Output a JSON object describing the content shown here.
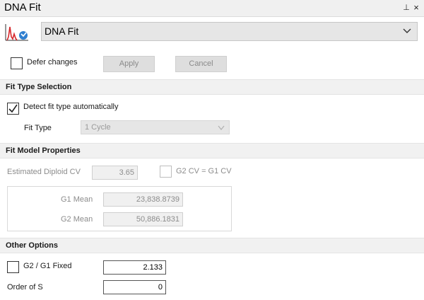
{
  "window": {
    "title": "DNA Fit",
    "pin_glyph": "⊥",
    "close_glyph": "×"
  },
  "selector": {
    "value": "DNA Fit",
    "icon": "dna-fit-histogram-icon"
  },
  "toolbar": {
    "defer_label": "Defer changes",
    "defer_checked": false,
    "apply_label": "Apply",
    "cancel_label": "Cancel"
  },
  "fit_type_selection": {
    "header": "Fit Type Selection",
    "detect_label": "Detect fit type automatically",
    "detect_checked": true,
    "fit_type_label": "Fit Type",
    "fit_type_value": "1 Cycle"
  },
  "fit_model": {
    "header": "Fit Model Properties",
    "diploid_cv_label": "Estimated Diploid CV",
    "diploid_cv_value": "3.65",
    "g2_cv_label": "G2 CV = G1 CV",
    "g2_cv_checked": false,
    "g1_mean_label": "G1 Mean",
    "g1_mean_value": "23,838.8739",
    "g2_mean_label": "G2 Mean",
    "g2_mean_value": "50,886.1831"
  },
  "other_options": {
    "header": "Other Options",
    "g2g1_label": "G2 / G1 Fixed",
    "g2g1_checked": false,
    "g2g1_value": "2.133",
    "order_s_label": "Order of S",
    "order_s_value": "0"
  },
  "colors": {
    "accent_blue": "#2f7fd0",
    "icon_red": "#d6262a",
    "section_bg": "#f1f1f1"
  }
}
